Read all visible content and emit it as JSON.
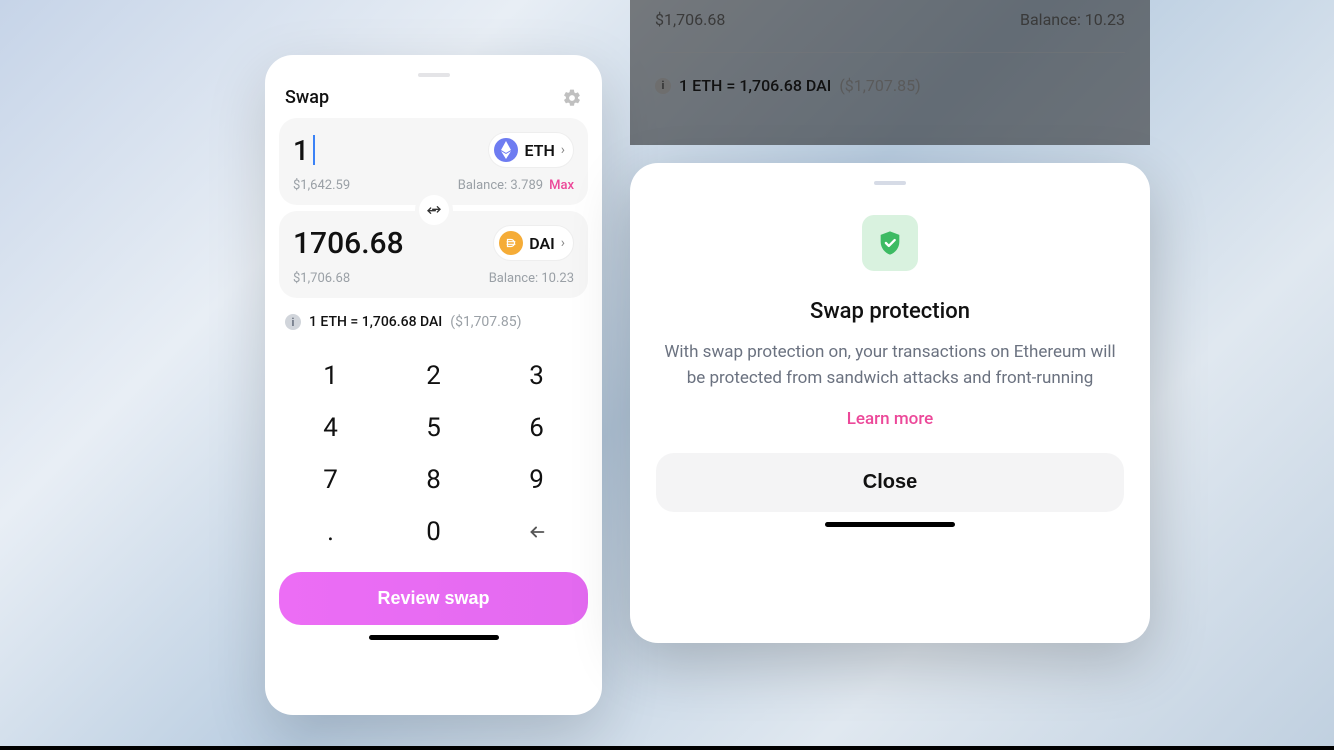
{
  "swap": {
    "title": "Swap",
    "from": {
      "amount": "1",
      "fiat": "$1,642.59",
      "symbol": "ETH",
      "balance_label": "Balance: 3.789",
      "max_label": "Max"
    },
    "to": {
      "amount": "1706.68",
      "fiat": "$1,706.68",
      "symbol": "DAI",
      "balance_label": "Balance: 10.23"
    },
    "rate": {
      "text": "1 ETH = 1,706.68 DAI",
      "fiat": "($1,707.85)"
    },
    "keypad": [
      "1",
      "2",
      "3",
      "4",
      "5",
      "6",
      "7",
      "8",
      "9",
      ".",
      "0"
    ],
    "review_label": "Review swap"
  },
  "bg": {
    "fiat": "$1,706.68",
    "balance": "Balance: 10.23",
    "rate_text": "1 ETH = 1,706.68 DAI",
    "rate_fiat": "($1,707.85)"
  },
  "sheet": {
    "title": "Swap protection",
    "body": "With swap protection on, your transactions on Ethereum will be protected from sandwich attacks and front-running",
    "learn_more": "Learn more",
    "close": "Close"
  }
}
